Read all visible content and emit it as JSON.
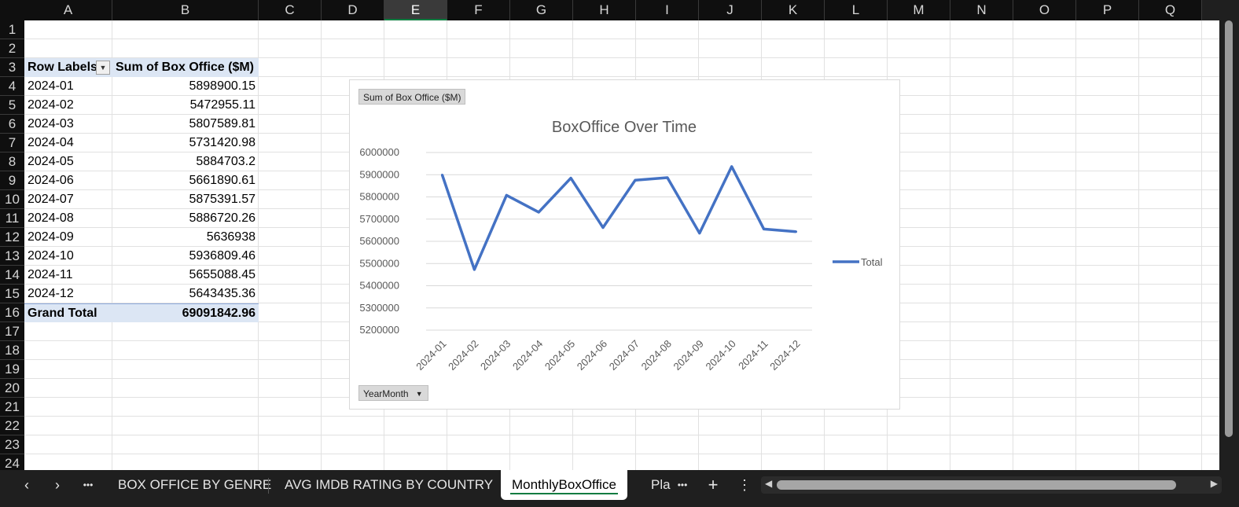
{
  "columns": [
    "A",
    "B",
    "C",
    "D",
    "E",
    "F",
    "G",
    "H",
    "I",
    "J",
    "K",
    "L",
    "M",
    "N",
    "O",
    "P",
    "Q"
  ],
  "selected_column": "E",
  "rows": [
    "1",
    "2",
    "3",
    "4",
    "5",
    "6",
    "7",
    "8",
    "9",
    "10",
    "11",
    "12",
    "13",
    "14",
    "15",
    "16",
    "17",
    "18",
    "19",
    "20",
    "21",
    "22",
    "23",
    "24"
  ],
  "pivot": {
    "header_row_labels": "Row Labels",
    "header_sum": "Sum of Box Office ($M)",
    "rows": [
      {
        "label": "2024-01",
        "value": "5898900.15"
      },
      {
        "label": "2024-02",
        "value": "5472955.11"
      },
      {
        "label": "2024-03",
        "value": "5807589.81"
      },
      {
        "label": "2024-04",
        "value": "5731420.98"
      },
      {
        "label": "2024-05",
        "value": "5884703.2"
      },
      {
        "label": "2024-06",
        "value": "5661890.61"
      },
      {
        "label": "2024-07",
        "value": "5875391.57"
      },
      {
        "label": "2024-08",
        "value": "5886720.26"
      },
      {
        "label": "2024-09",
        "value": "5636938"
      },
      {
        "label": "2024-10",
        "value": "5936809.46"
      },
      {
        "label": "2024-11",
        "value": "5655088.45"
      },
      {
        "label": "2024-12",
        "value": "5643435.36"
      }
    ],
    "total_label": "Grand Total",
    "total_value": "69091842.96"
  },
  "chart_field_buttons": {
    "values": "Sum of Box Office ($M)",
    "axis": "YearMonth"
  },
  "chart_data": {
    "type": "line",
    "title": "BoxOffice Over Time",
    "categories": [
      "2024-01",
      "2024-02",
      "2024-03",
      "2024-04",
      "2024-05",
      "2024-06",
      "2024-07",
      "2024-08",
      "2024-09",
      "2024-10",
      "2024-11",
      "2024-12"
    ],
    "series": [
      {
        "name": "Total",
        "values": [
          5898900.15,
          5472955.11,
          5807589.81,
          5731420.98,
          5884703.2,
          5661890.61,
          5875391.57,
          5886720.26,
          5636938,
          5936809.46,
          5655088.45,
          5643435.36
        ]
      }
    ],
    "y_ticks": [
      "6000000",
      "5900000",
      "5800000",
      "5700000",
      "5600000",
      "5500000",
      "5400000",
      "5300000",
      "5200000"
    ],
    "ylim": [
      5200000,
      6000000
    ],
    "grid": true,
    "legend": "right",
    "line_color": "#4472c4"
  },
  "tabs": {
    "items": [
      "BOX OFFICE BY GENRE",
      "AVG IMDB RATING BY COUNTRY",
      "MonthlyBoxOffice",
      "Pla"
    ],
    "active": "MonthlyBoxOffice",
    "nav_prev": "‹",
    "nav_next": "›",
    "more": "•••",
    "add": "+",
    "options": "⋮"
  }
}
